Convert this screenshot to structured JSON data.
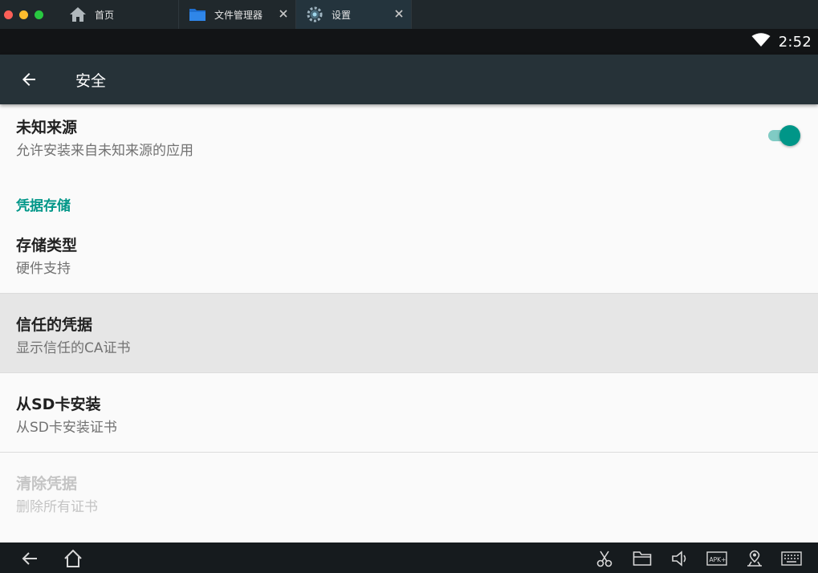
{
  "tabs": [
    {
      "label": "首页",
      "icon": "home-icon",
      "closable": false
    },
    {
      "label": "文件管理器",
      "icon": "folder-icon",
      "closable": true
    },
    {
      "label": "设置",
      "icon": "settings-gear-icon",
      "closable": true,
      "active": true
    }
  ],
  "status": {
    "time": "2:52",
    "wifi_icon": "wifi-icon"
  },
  "toolbar": {
    "title": "安全",
    "back_icon": "arrow-back-icon"
  },
  "settings": {
    "unknown_sources": {
      "title": "未知来源",
      "summary": "允许安装来自未知来源的应用",
      "enabled": true
    },
    "category": "凭据存储",
    "storage_type": {
      "title": "存储类型",
      "summary": "硬件支持"
    },
    "trusted_credentials": {
      "title": "信任的凭据",
      "summary": "显示信任的CA证书"
    },
    "install_from_sd": {
      "title": "从SD卡安装",
      "summary": "从SD卡安装证书"
    },
    "clear_credentials": {
      "title": "清除凭据",
      "summary": "删除所有证书",
      "disabled": true
    }
  },
  "navbar": {
    "left": [
      "back-icon",
      "home-icon"
    ],
    "right": [
      "scissors-icon",
      "folder-icon",
      "volume-icon",
      "apk-install-icon",
      "location-icon",
      "keyboard-icon"
    ]
  },
  "colors": {
    "accent": "#009688",
    "toolbar": "#263238",
    "status_bar": "#121416",
    "highlight_row": "#e6e6e6",
    "traffic_red": "#fc5f57",
    "traffic_yellow": "#fdbc2e",
    "traffic_green": "#28c840"
  }
}
